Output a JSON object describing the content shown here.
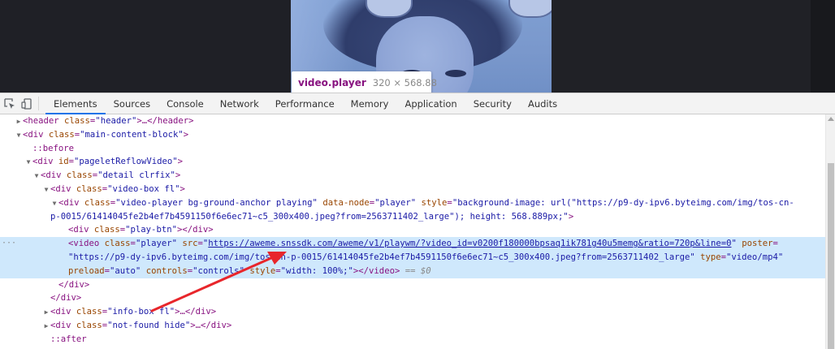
{
  "tooltip": {
    "element": "video.player",
    "size": "320 × 568.88"
  },
  "tabs": [
    "Elements",
    "Sources",
    "Console",
    "Network",
    "Performance",
    "Memory",
    "Application",
    "Security",
    "Audits"
  ],
  "active_tab": "Elements",
  "tree": {
    "r1_tag": "<header ",
    "r1_an": "class",
    "r1_av": "\"header\"",
    "r1_end": ">…</header>",
    "r2_tag": "<div ",
    "r2_an": "class",
    "r2_av": "\"main-content-block\"",
    "r2_end": ">",
    "r3_pseudo": "::before",
    "r4_tag": "<div ",
    "r4_an": "id",
    "r4_av": "\"pageletReflowVideo\"",
    "r4_end": ">",
    "r5_tag": "<div ",
    "r5_an": "class",
    "r5_av": "\"detail clrfix\"",
    "r5_end": ">",
    "r6_tag": "<div ",
    "r6_an": "class",
    "r6_av": "\"video-box fl\"",
    "r6_end": ">",
    "r7_tag": "<div ",
    "r7_an1": "class",
    "r7_av1": "\"video-player bg-ground-anchor playing\"",
    "r7_an2": "data-node",
    "r7_av2": "\"player\"",
    "r7_an3": "style",
    "r7_av3a": "\"background-image: url(\"https://p9-dy-ipv6.byteimg.com/img/tos-cn-",
    "r8_av3b": "p-0015/61414045fe2b4ef7b4591150f6e6ec71~c5_300x400.jpeg?from=2563711402_large\"); height: 568.889px;\"",
    "r8_end": ">",
    "r9_tag": "<div ",
    "r9_an": "class",
    "r9_av": "\"play-btn\"",
    "r9_end": "></div>",
    "r10_tag": "<video ",
    "r10_an1": "class",
    "r10_av1": "\"player\"",
    "r10_an2": "src",
    "r10_q": "\"",
    "r10_link": "https://aweme.snssdk.com/aweme/v1/playwm/?video_id=v0200f180000bpsaq1ik781g40u5memg&ratio=720p&line=0",
    "r10_an3": "poster",
    "r11_av": "\"https://p9-dy-ipv6.byteimg.com/img/tos-cn-p-0015/61414045fe2b4ef7b4591150f6e6ec71~c5_300x400.jpeg?from=2563711402_large\"",
    "r11_an": "type",
    "r11_av2": "\"video/mp4\"",
    "r12_an1": "preload",
    "r12_av1": "\"auto\"",
    "r12_an2": "controls",
    "r12_an3": "controls",
    "r12_an4": "style",
    "r12_av4": "\"width: 100%;\"",
    "r12_end": "></video>",
    "r12_eq": "== $0",
    "r13": "</div>",
    "r14": "</div>",
    "r15_tag": "<div ",
    "r15_an": "class",
    "r15_av": "\"info-box fl\"",
    "r15_end": ">…</div>",
    "r16_tag": "<div ",
    "r16_an": "class",
    "r16_av": "\"not-found hide\"",
    "r16_end": ">…</div>",
    "r17_pseudo": "::after"
  },
  "colors": {
    "tag": "#881280",
    "attr_name": "#994500",
    "attr_value": "#1a1aa6",
    "selection": "#cfe8fc",
    "annotation_arrow": "#e8262b"
  },
  "icons": [
    "inspect-element-icon",
    "device-toolbar-icon"
  ]
}
